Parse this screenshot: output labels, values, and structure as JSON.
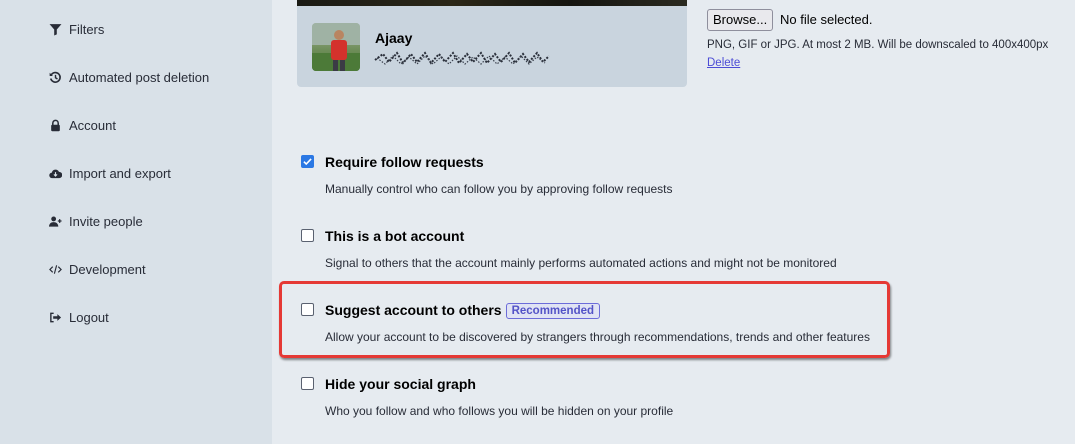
{
  "sidebar": {
    "items": [
      {
        "label": "Filters",
        "icon": "filter-icon"
      },
      {
        "label": "Automated post deletion",
        "icon": "history-icon"
      },
      {
        "label": "Account",
        "icon": "lock-icon"
      },
      {
        "label": "Import and export",
        "icon": "cloud-download-icon"
      },
      {
        "label": "Invite people",
        "icon": "user-plus-icon"
      },
      {
        "label": "Development",
        "icon": "code-icon"
      },
      {
        "label": "Logout",
        "icon": "sign-out-icon"
      }
    ]
  },
  "profile_preview": {
    "display_name": "Ajaay"
  },
  "avatar_upload": {
    "browse_label": "Browse...",
    "status": "No file selected.",
    "hint": "PNG, GIF or JPG. At most 2 MB. Will be downscaled to 400x400px",
    "delete_label": "Delete"
  },
  "options": [
    {
      "title": "Require follow requests",
      "description": "Manually control who can follow you by approving follow requests",
      "checked": true
    },
    {
      "title": "This is a bot account",
      "description": "Signal to others that the account mainly performs automated actions and might not be monitored",
      "checked": false
    },
    {
      "title": "Suggest account to others",
      "badge": "Recommended",
      "description": "Allow your account to be discovered by strangers through recommendations, trends and other features",
      "checked": false
    },
    {
      "title": "Hide your social graph",
      "description": "Who you follow and who follows you will be hidden on your profile",
      "checked": false
    }
  ],
  "colors": {
    "sidebar_bg": "#d9e1e8",
    "main_bg": "#e6ebf0",
    "checkbox_checked": "#2b78e4",
    "highlight": "#e53935",
    "link": "#4c4cd6"
  }
}
